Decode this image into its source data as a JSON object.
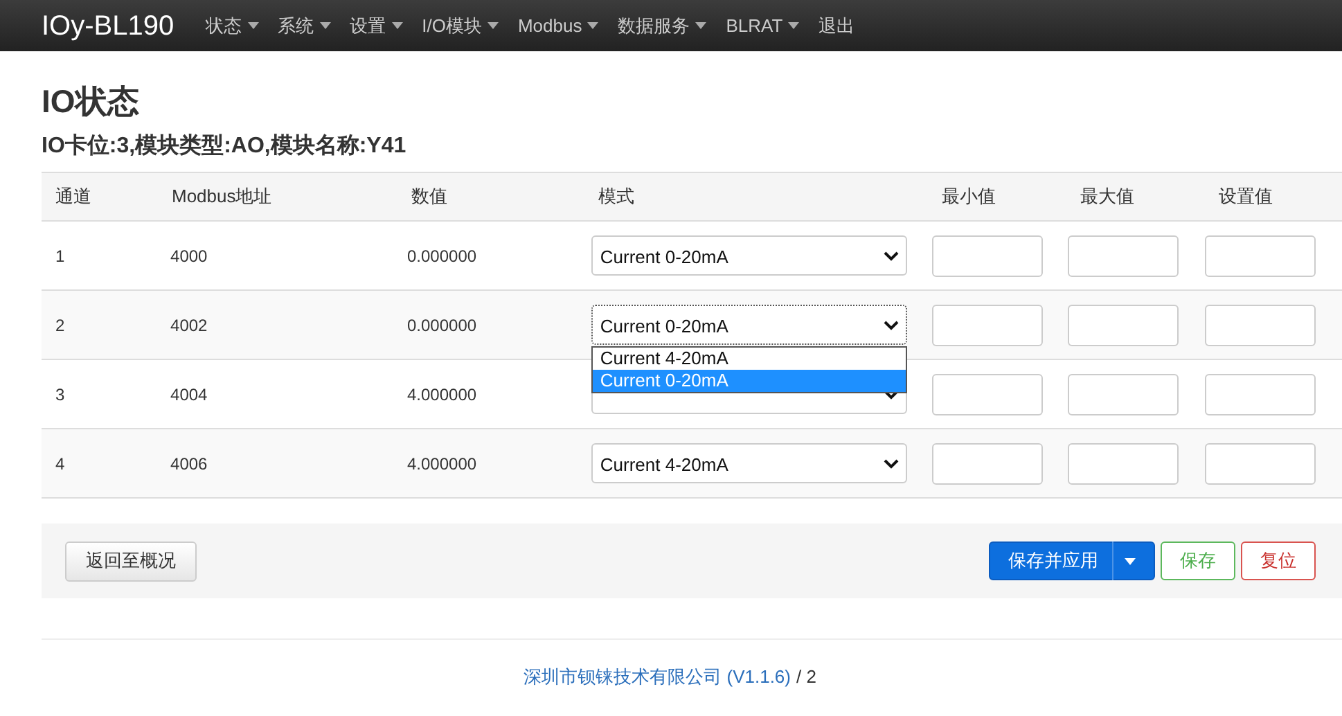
{
  "brand": "IOy-BL190",
  "nav": [
    {
      "label": "状态",
      "dropdown": true
    },
    {
      "label": "系统",
      "dropdown": true
    },
    {
      "label": "设置",
      "dropdown": true
    },
    {
      "label": "I/O模块",
      "dropdown": true
    },
    {
      "label": "Modbus",
      "dropdown": true
    },
    {
      "label": "数据服务",
      "dropdown": true
    },
    {
      "label": "BLRAT",
      "dropdown": true
    },
    {
      "label": "退出",
      "dropdown": false
    }
  ],
  "title": "IO状态",
  "subtitle": "IO卡位:3,模块类型:AO,模块名称:Y41",
  "table": {
    "columns": [
      "通道",
      "Modbus地址",
      "数值",
      "模式",
      "最小值",
      "最大值",
      "设置值"
    ],
    "rows": [
      {
        "channel": "1",
        "address": "4000",
        "value": "0.000000",
        "mode": "Current 0-20mA",
        "expanded": false
      },
      {
        "channel": "2",
        "address": "4002",
        "value": "0.000000",
        "mode": "Current 0-20mA",
        "expanded": true,
        "options": [
          {
            "label": "Current 4-20mA",
            "selected": false
          },
          {
            "label": "Current 0-20mA",
            "selected": true
          }
        ]
      },
      {
        "channel": "3",
        "address": "4004",
        "value": "4.000000",
        "expanded": false
      },
      {
        "channel": "4",
        "address": "4006",
        "value": "4.000000",
        "mode": "Current 4-20mA",
        "expanded": false
      }
    ]
  },
  "back_button": "返回至概况",
  "actions": [
    {
      "label": "保存并应用",
      "kind": "primary"
    },
    {
      "label": "保存",
      "kind": "success"
    },
    {
      "label": "复位",
      "kind": "danger"
    }
  ],
  "footer": {
    "link": "深圳市钡铼技术有限公司 (V1.1.6)",
    "rest": "/ 2"
  }
}
